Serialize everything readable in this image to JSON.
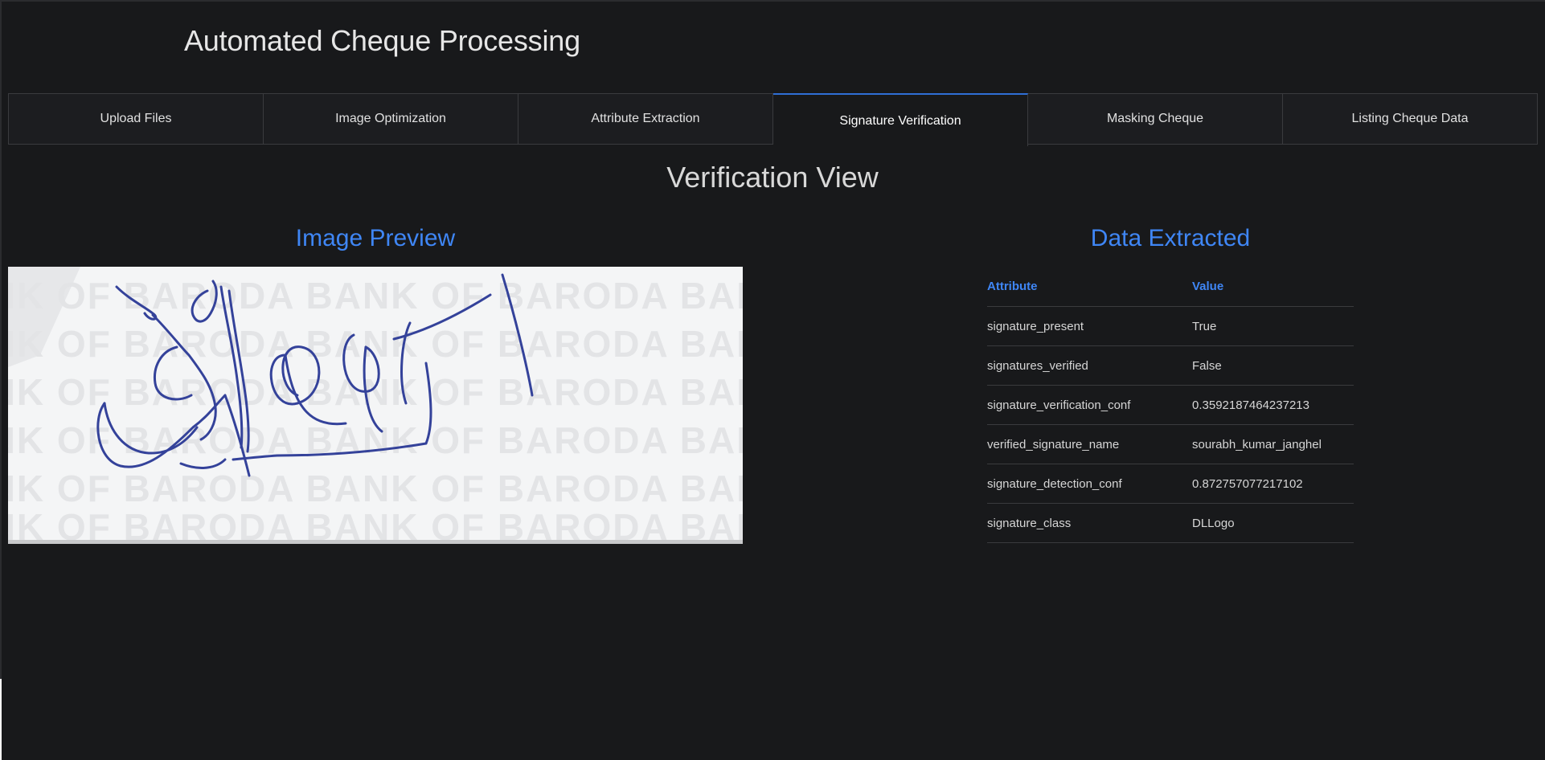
{
  "app": {
    "title": "Automated Cheque Processing"
  },
  "tabs": [
    {
      "label": "Upload Files",
      "active": false
    },
    {
      "label": "Image Optimization",
      "active": false
    },
    {
      "label": "Attribute Extraction",
      "active": false
    },
    {
      "label": "Signature Verification",
      "active": true
    },
    {
      "label": "Masking Cheque",
      "active": false
    },
    {
      "label": "Listing Cheque Data",
      "active": false
    }
  ],
  "view": {
    "title": "Verification View",
    "image_preview_heading": "Image Preview",
    "data_heading": "Data Extracted",
    "watermark_text": "BANK OF BARODA"
  },
  "table": {
    "headers": {
      "attribute": "Attribute",
      "value": "Value"
    },
    "rows": [
      {
        "attribute": "signature_present",
        "value": "True"
      },
      {
        "attribute": "signatures_verified",
        "value": "False"
      },
      {
        "attribute": "signature_verification_conf",
        "value": "0.3592187464237213"
      },
      {
        "attribute": "verified_signature_name",
        "value": "sourabh_kumar_janghel"
      },
      {
        "attribute": "signature_detection_conf",
        "value": "0.872757077217102"
      },
      {
        "attribute": "signature_class",
        "value": "DLLogo"
      }
    ]
  },
  "colors": {
    "background": "#18191b",
    "accent": "#3f86f5",
    "ink": "#34429a"
  }
}
